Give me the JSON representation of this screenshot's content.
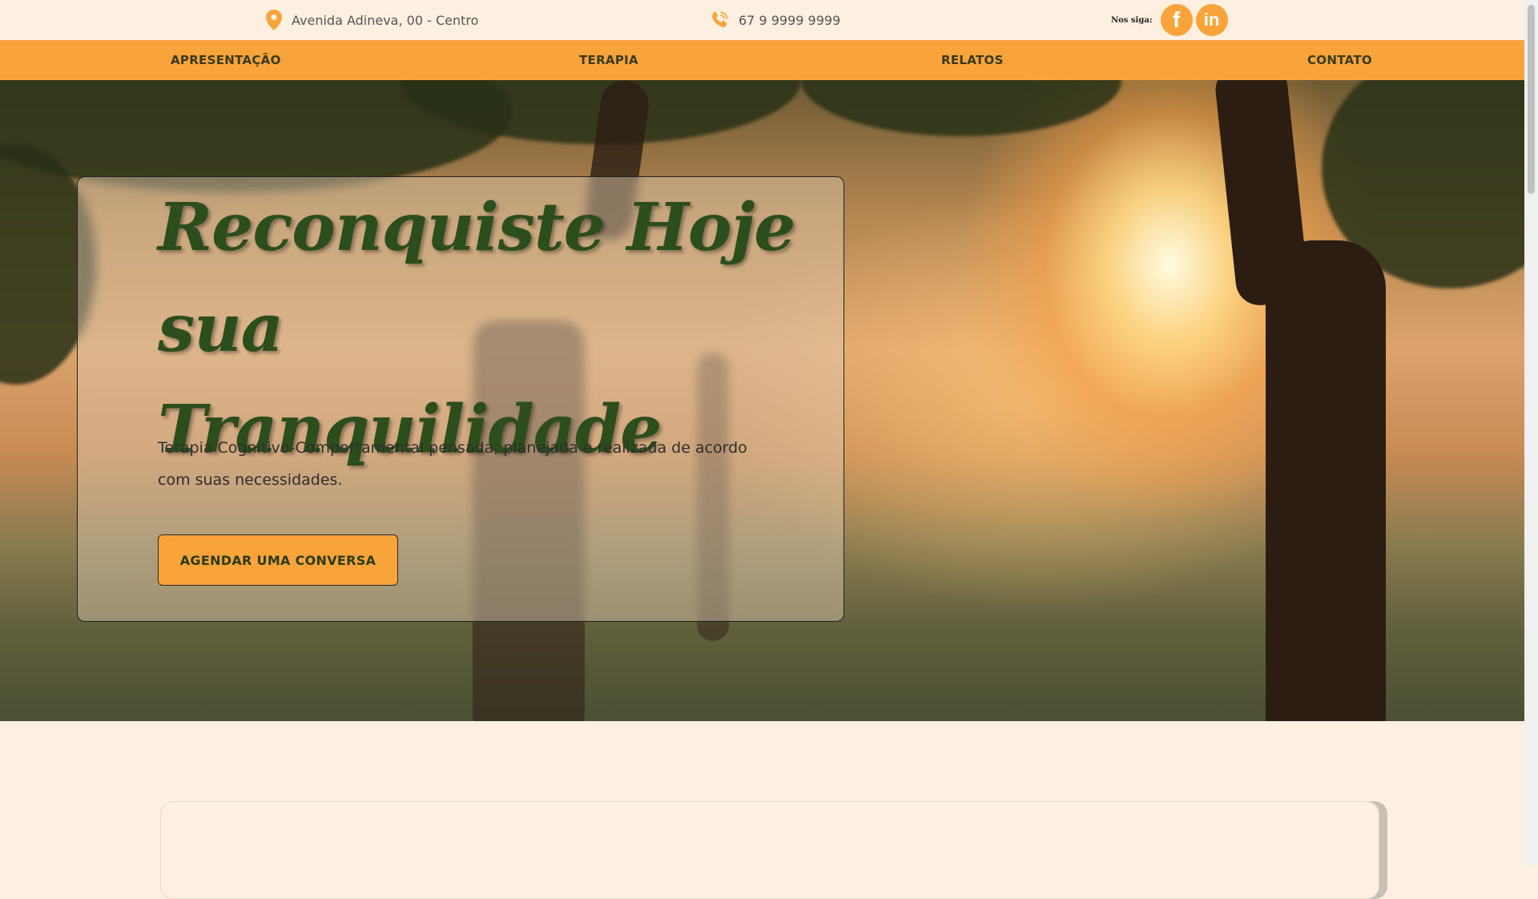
{
  "topbar": {
    "address": "Avenida Adineva, 00 - Centro",
    "phone": "67 9 9999 9999",
    "social_label": "Nos siga:",
    "facebook_glyph": "f",
    "linkedin_glyph": "in"
  },
  "nav": {
    "items": [
      {
        "label": "APRESENTAÇÃO"
      },
      {
        "label": "TERAPIA"
      },
      {
        "label": "RELATOS"
      },
      {
        "label": "CONTATO"
      }
    ]
  },
  "hero": {
    "headline_line1": "Reconquiste Hoje",
    "headline_line2": "sua Tranquilidade",
    "lead": "Terapia Cognitivo-Comportamental pensada, planejada e realizada de acordo com suas necessidades.",
    "cta_label": "AGENDAR UMA CONVERSA"
  },
  "colors": {
    "accent": "#f8a43a",
    "background": "#fdf0e1",
    "headline": "#2c4d1c"
  },
  "icons": [
    "location-pin-icon",
    "phone-icon",
    "facebook-icon",
    "linkedin-icon"
  ]
}
